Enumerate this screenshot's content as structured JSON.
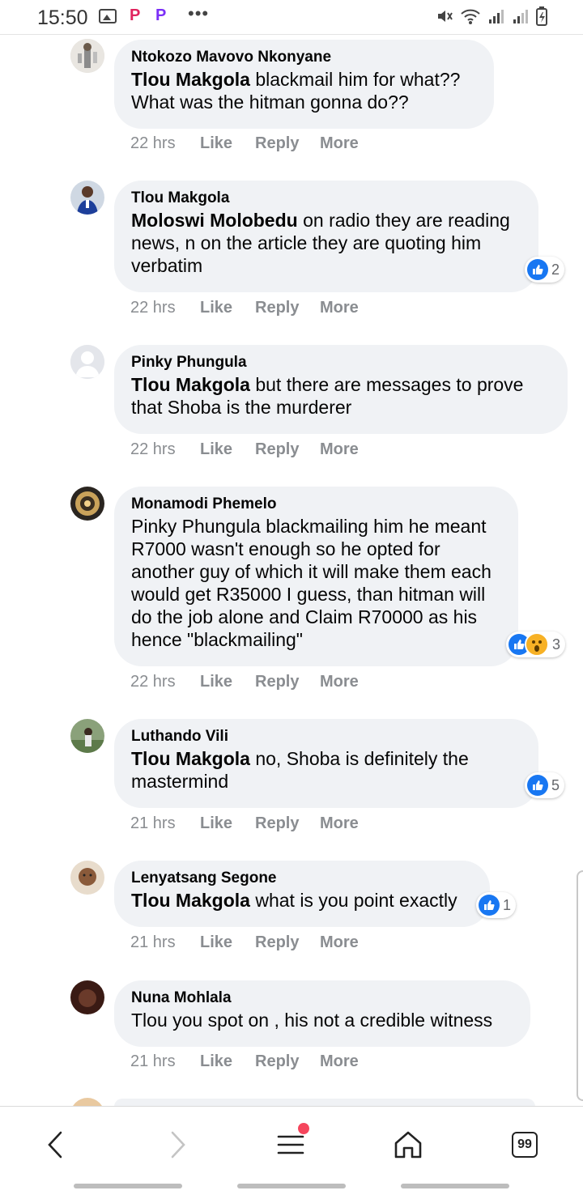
{
  "status_bar": {
    "time": "15:50",
    "icons_left": [
      "gallery-icon",
      "pinterest-like-p-icon",
      "picsart-p-icon",
      "more-dots-icon"
    ],
    "dots": "•••",
    "p1": "P",
    "p2": "P",
    "icons_right": [
      "mute-icon",
      "wifi-icon",
      "signal-icon",
      "signal-icon",
      "battery-charging-icon"
    ]
  },
  "actions": {
    "like": "Like",
    "reply": "Reply",
    "more": "More"
  },
  "comments": [
    {
      "author": "Ntokozo Mavovo Nkonyane",
      "mention": "Tlou Makgola",
      "text": " blackmail him for what?? What was the hitman gonna do??",
      "time": "22 hrs",
      "reactions": null
    },
    {
      "author": "Tlou Makgola",
      "mention": "Moloswi Molobedu",
      "text": " on radio they are reading news, n on the article they are quoting him verbatim",
      "time": "22 hrs",
      "reactions": "2"
    },
    {
      "author": "Pinky Phungula",
      "mention": "Tlou Makgola",
      "text": " but there are messages to prove that Shoba is the murderer",
      "time": "22 hrs",
      "reactions": null
    },
    {
      "author": "Monamodi Phemelo",
      "mention": "",
      "text": "Pinky Phungula blackmailing him he meant R7000 wasn't enough so he opted for another guy of which it will make them each would get R35000 I guess, than hitman will do the job alone and Claim R70000 as his hence \"blackmailing\"",
      "time": "22 hrs",
      "reactions": "3"
    },
    {
      "author": "Luthando Vili",
      "mention": "Tlou Makgola",
      "text": " no, Shoba is definitely the mastermind",
      "time": "21 hrs",
      "reactions": "5"
    },
    {
      "author": "Lenyatsang Segone",
      "mention": "Tlou Makgola",
      "text": " what is you point exactly",
      "time": "21 hrs",
      "reactions": "1"
    },
    {
      "author": "Nuna Mohlala",
      "mention": "",
      "text": "Tlou you spot on , his not a credible witness",
      "time": "21 hrs",
      "reactions": null
    }
  ],
  "bottom_nav": {
    "back": "back-icon",
    "forward": "forward-icon",
    "menu": "menu-icon",
    "home": "home-icon",
    "tabs_count": "99"
  },
  "colors": {
    "bubble": "#f0f2f5",
    "meta_text": "#8a8d91",
    "like_blue": "#1877f2",
    "wow_yellow": "#f7b125",
    "notification_dot": "#f5455c"
  }
}
